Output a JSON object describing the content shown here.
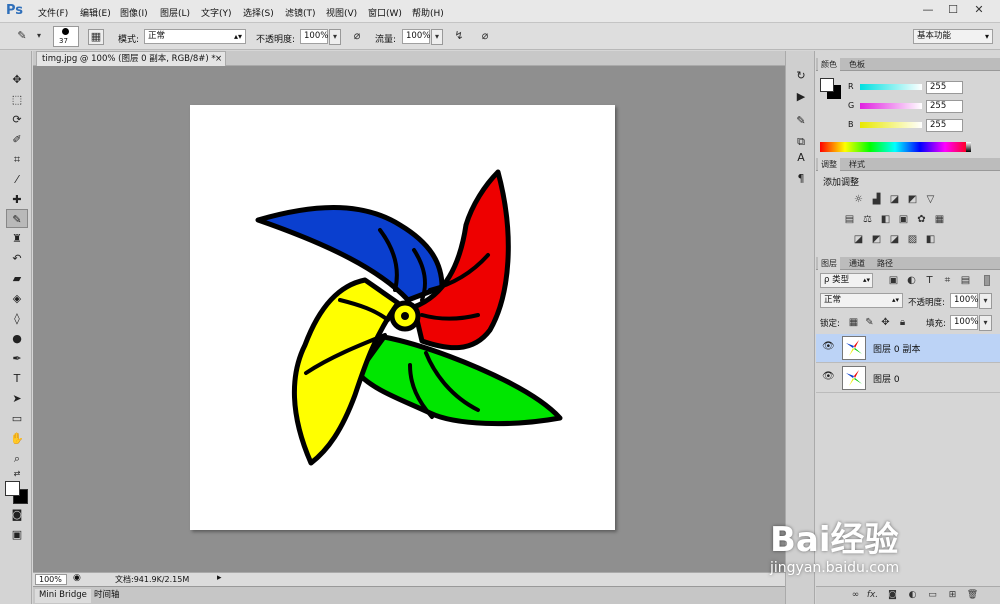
{
  "app": {
    "logo": "Ps"
  },
  "menu": [
    "文件(F)",
    "编辑(E)",
    "图像(I)",
    "图层(L)",
    "文字(Y)",
    "选择(S)",
    "滤镜(T)",
    "视图(V)",
    "窗口(W)",
    "帮助(H)"
  ],
  "window_controls": {
    "minimize": "—",
    "restore": "☐",
    "close": "✕"
  },
  "options": {
    "brush_size": "37",
    "mode_label": "模式:",
    "mode_value": "正常",
    "opacity_label": "不透明度:",
    "opacity_value": "100%",
    "flow_label": "流量:",
    "flow_value": "100%",
    "workspace": "基本功能"
  },
  "document": {
    "tab_title": "timg.jpg @ 100% (图层 0 副本, RGB/8#) *",
    "tab_close": "×"
  },
  "status": {
    "zoom": "100%",
    "doc_info": "文档:941.9K/2.15M"
  },
  "bottom_tabs": [
    "Mini Bridge",
    "时间轴"
  ],
  "color_panel": {
    "tabs": [
      "颜色",
      "色板"
    ],
    "channels": [
      {
        "label": "R",
        "value": "255",
        "color": "#00c8c8"
      },
      {
        "label": "G",
        "value": "255",
        "color": "#e020e0"
      },
      {
        "label": "B",
        "value": "255",
        "color": "#e8e800"
      }
    ]
  },
  "adjust_panel": {
    "tabs": [
      "调整",
      "样式"
    ],
    "title": "添加调整"
  },
  "layers_panel": {
    "tabs": [
      "图层",
      "通道",
      "路径"
    ],
    "filter_label": "ρ 类型",
    "blend_mode": "正常",
    "opacity_label": "不透明度:",
    "opacity_value": "100%",
    "lock_label": "锁定:",
    "fill_label": "填充:",
    "fill_value": "100%",
    "layers": [
      {
        "name": "图层 0 副本",
        "selected": true
      },
      {
        "name": "图层 0",
        "selected": false
      }
    ],
    "footer_fx": "fx."
  },
  "watermark": {
    "brand": "Bai经验",
    "url": "jingyan.baidu.com"
  },
  "colors": {
    "selection": "#bcd3f6",
    "pinwheel_blue": "#0a3fcf",
    "pinwheel_red": "#ee0000",
    "pinwheel_yellow": "#ffff00",
    "pinwheel_green": "#00e600"
  }
}
